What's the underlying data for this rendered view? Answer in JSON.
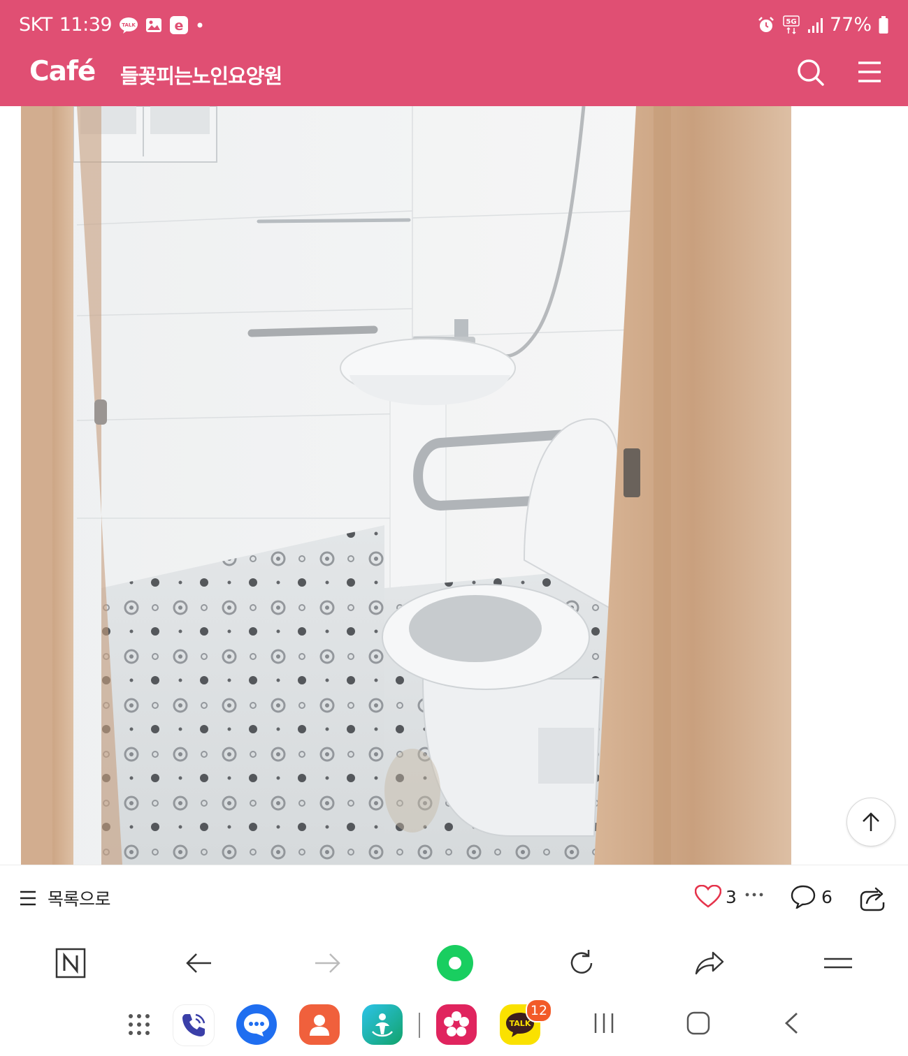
{
  "status_bar": {
    "carrier": "SKT",
    "time": "11:39",
    "network": "5G",
    "battery": "77%",
    "notification_icons": [
      "kakaotalk-icon",
      "gallery-icon",
      "samsung-internet-icon",
      "dot-icon"
    ],
    "system_icons": [
      "alarm-icon",
      "network-5g-icon",
      "signal-icon",
      "battery-icon"
    ]
  },
  "header": {
    "logo": "Café",
    "cafe_name": "들꽃피는노인요양원",
    "color": "#e04f73"
  },
  "article_bar": {
    "to_list_label": "목록으로",
    "like_count": "3",
    "comment_count": "6"
  },
  "browser_toolbar": {
    "buttons": [
      "naver-home-icon",
      "back-arrow-icon",
      "forward-arrow-icon",
      "green-dot-icon",
      "refresh-icon",
      "share-arrow-icon",
      "menu-icon"
    ]
  },
  "dock": {
    "apps": [
      "apps-grid-icon",
      "phone-icon",
      "messages-icon",
      "contacts-icon",
      "bixby-icon",
      "gallery-flower-icon",
      "kakaotalk-icon"
    ],
    "kakaotalk_badge": "12",
    "kakaotalk_label": "TALK"
  },
  "system_nav": [
    "recent-apps-icon",
    "home-icon",
    "back-icon"
  ]
}
